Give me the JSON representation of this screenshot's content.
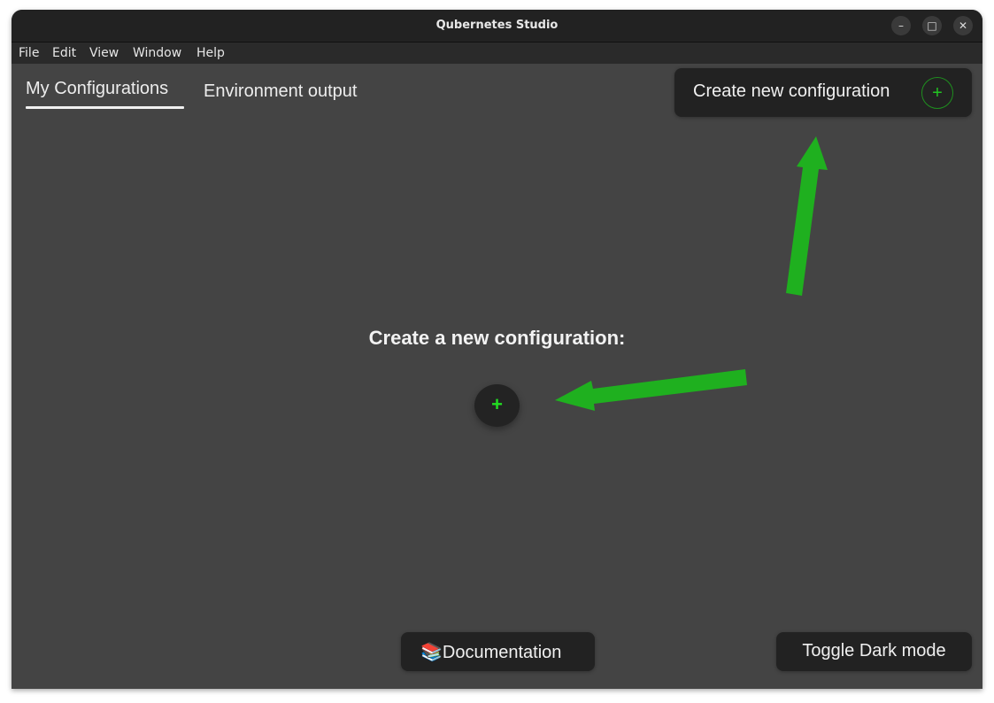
{
  "window": {
    "title": "Qubernetes Studio",
    "controls": {
      "minimize": "–",
      "maximize": "□",
      "close": "✕"
    }
  },
  "menubar": {
    "items": [
      "File",
      "Edit",
      "View",
      "Window",
      "Help"
    ]
  },
  "tabs": [
    {
      "label": "My Configurations",
      "active": true
    },
    {
      "label": "Environment output",
      "active": false
    }
  ],
  "toolbar": {
    "create_label": "Create new configuration",
    "create_icon": "+"
  },
  "main": {
    "heading": "Create a new configuration:",
    "add_icon": "+"
  },
  "footer": {
    "doc_icon": "📚",
    "doc_label": "Documentation",
    "dark_mode_label": "Toggle Dark mode"
  },
  "colors": {
    "accent_green": "#1fb01f",
    "plus_green": "#22dd22",
    "window_bg": "#444444",
    "button_bg": "#222222"
  }
}
